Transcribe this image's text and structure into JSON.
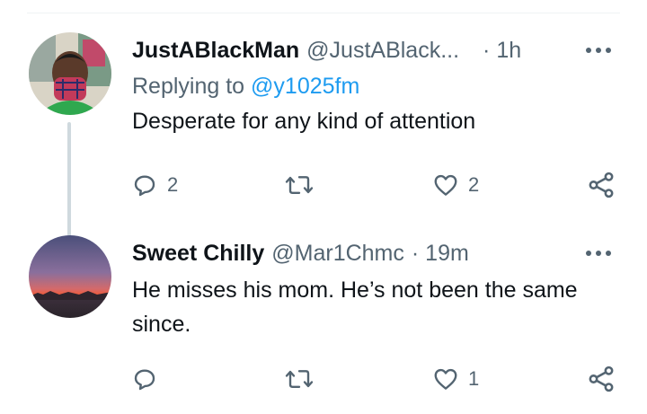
{
  "tweets": [
    {
      "display_name": "JustABlackMan",
      "handle": "@JustABlack...",
      "time": "· 1h",
      "replying_prefix": "Replying to",
      "replying_to": "@y1025fm",
      "text": "Desperate for any kind of attention",
      "reply_count": "2",
      "retweet_count": "",
      "like_count": "2"
    },
    {
      "display_name": "Sweet Chilly",
      "handle": "@Mar1Chmc",
      "time": "· 19m",
      "text": "He misses his mom. He’s not been the same since.",
      "reply_count": "",
      "retweet_count": "",
      "like_count": "1"
    }
  ],
  "colors": {
    "text_primary": "#0f1419",
    "text_secondary": "#536471",
    "link": "#1d9bf0",
    "thread_line": "#cfd9de"
  },
  "icons": [
    "reply-icon",
    "retweet-icon",
    "like-icon",
    "share-icon",
    "more-icon"
  ]
}
